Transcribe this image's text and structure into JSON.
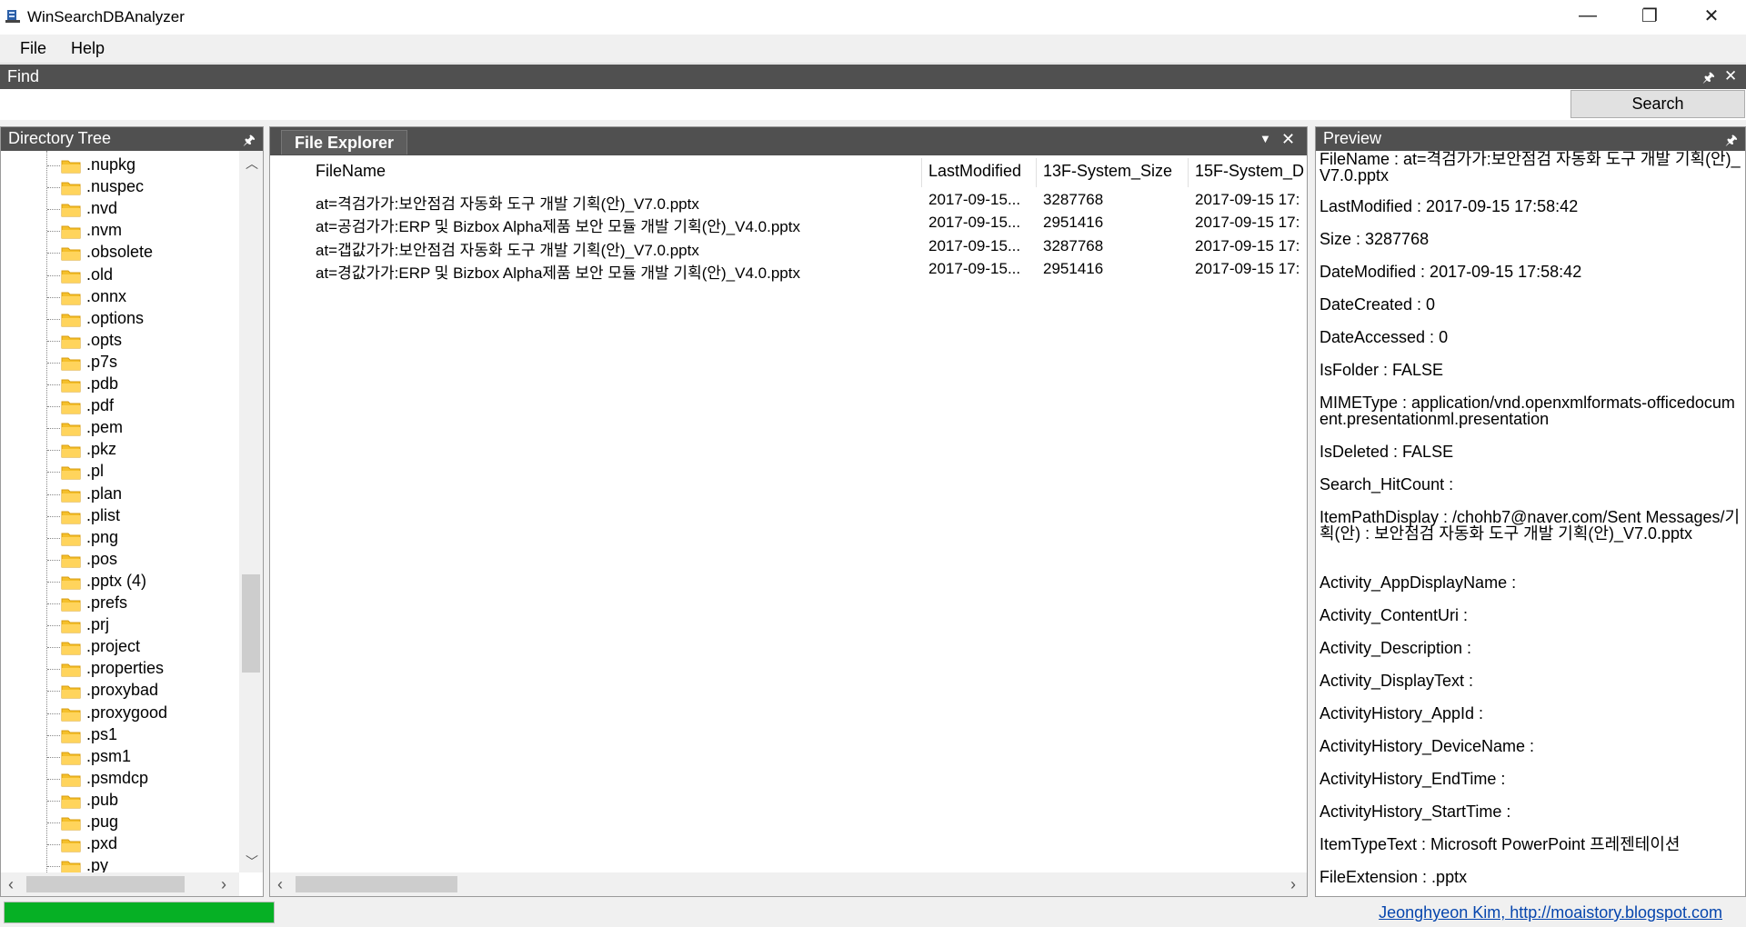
{
  "window": {
    "title": "WinSearchDBAnalyzer",
    "minimize_glyph": "—",
    "restore_glyph": "❐",
    "close_glyph": "✕"
  },
  "menu": {
    "items": [
      "File",
      "Help"
    ]
  },
  "find": {
    "title": "Find",
    "query": "",
    "search_label": "Search"
  },
  "directory_tree": {
    "title": "Directory Tree",
    "items": [
      ".nupkg",
      ".nuspec",
      ".nvd",
      ".nvm",
      ".obsolete",
      ".old",
      ".onnx",
      ".options",
      ".opts",
      ".p7s",
      ".pdb",
      ".pdf",
      ".pem",
      ".pkz",
      ".pl",
      ".plan",
      ".plist",
      ".png",
      ".pos",
      ".pptx (4)",
      ".prefs",
      ".prj",
      ".project",
      ".properties",
      ".proxybad",
      ".proxygood",
      ".ps1",
      ".psm1",
      ".psmdcp",
      ".pub",
      ".pug",
      ".pxd",
      ".py"
    ]
  },
  "file_explorer": {
    "tab": "File Explorer",
    "columns": [
      "FileName",
      "LastModified",
      "13F-System_Size",
      "15F-System_D"
    ],
    "rows": [
      [
        "at=격검가가:보안점검 자동화 도구 개발 기획(안)_V7.0.pptx",
        "2017-09-15...",
        "3287768",
        "2017-09-15 17:"
      ],
      [
        "at=공검가가:ERP 및 Bizbox Alpha제품 보안 모듈 개발 기획(안)_V4.0.pptx",
        "2017-09-15...",
        "2951416",
        "2017-09-15 17:"
      ],
      [
        "at=갭값가가:보안점검 자동화 도구 개발 기획(안)_V7.0.pptx",
        "2017-09-15...",
        "3287768",
        "2017-09-15 17:"
      ],
      [
        "at=경값가가:ERP 및 Bizbox Alpha제품 보안 모듈 개발 기획(안)_V4.0.pptx",
        "2017-09-15...",
        "2951416",
        "2017-09-15 17:"
      ]
    ]
  },
  "preview": {
    "title": "Preview",
    "props": [
      "FileName : at=격검가가:보안점검 자동화 도구 개발 기획(안)_V7.0.pptx",
      "LastModified : 2017-09-15 17:58:42",
      "Size : 3287768",
      "DateModified : 2017-09-15 17:58:42",
      "DateCreated : 0",
      "DateAccessed : 0",
      "IsFolder : FALSE",
      "MIMEType : application/vnd.openxmlformats-officedocument.presentationml.presentation",
      "IsDeleted : FALSE",
      "Search_HitCount :",
      "ItemPathDisplay : /chohb7@naver.com/Sent Messages/기획(안) : 보안점검 자동화 도구 개발 기획(안)_V7.0.pptx",
      "Activity_AppDisplayName :",
      "Activity_ContentUri :",
      "Activity_Description :",
      "Activity_DisplayText :",
      "ActivityHistory_AppId :",
      "ActivityHistory_DeviceName :",
      "ActivityHistory_EndTime :",
      "ActivityHistory_StartTime :",
      "ItemTypeText : Microsoft PowerPoint 프레젠테이션",
      "FileExtension : .pptx"
    ]
  },
  "status": {
    "progress": 1.0,
    "progress_color": "#06b025",
    "credit": "Jeonghyeon Kim, http://moaistory.blogspot.com"
  },
  "icons": {
    "app": "app-icon",
    "folder": "folder-icon",
    "pin": "pin-icon",
    "close": "close-icon"
  }
}
